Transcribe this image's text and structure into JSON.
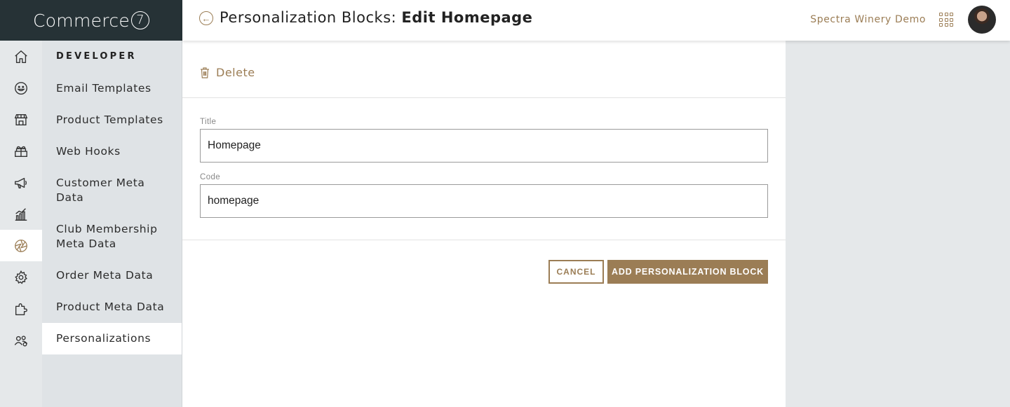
{
  "brand": {
    "name": "Commerce",
    "mark": "7"
  },
  "header": {
    "title_prefix": "Personalization Blocks: ",
    "title_strong": "Edit Homepage",
    "back_glyph": "←",
    "store_name": "Spectra Winery Demo"
  },
  "rail": {
    "items": [
      {
        "icon": "home-icon"
      },
      {
        "icon": "smiley-icon"
      },
      {
        "icon": "store-icon"
      },
      {
        "icon": "gift-box-icon"
      },
      {
        "icon": "megaphone-icon"
      },
      {
        "icon": "bar-chart-icon"
      },
      {
        "icon": "aperture-icon",
        "active": true
      },
      {
        "icon": "gear-icon"
      },
      {
        "icon": "puzzle-icon"
      },
      {
        "icon": "users-icon"
      }
    ]
  },
  "subnav": {
    "heading": "DEVELOPER",
    "items": [
      {
        "label": "Email Templates"
      },
      {
        "label": "Product Templates"
      },
      {
        "label": "Web Hooks"
      },
      {
        "label": "Customer Meta Data"
      },
      {
        "label": "Club Membership Meta Data"
      },
      {
        "label": "Order Meta Data"
      },
      {
        "label": "Product Meta Data"
      },
      {
        "label": "Personalizations",
        "active": true
      }
    ]
  },
  "form": {
    "delete_label": "Delete",
    "title_label": "Title",
    "title_value": "Homepage",
    "code_label": "Code",
    "code_value": "homepage",
    "cancel_label": "CANCEL",
    "submit_label": "ADD PERSONALIZATION BLOCK"
  },
  "colors": {
    "accent": "#9b7d55",
    "brand_bg": "#263236",
    "rail_bg": "#e5e8ea",
    "subnav_bg": "#dfe3e6"
  }
}
